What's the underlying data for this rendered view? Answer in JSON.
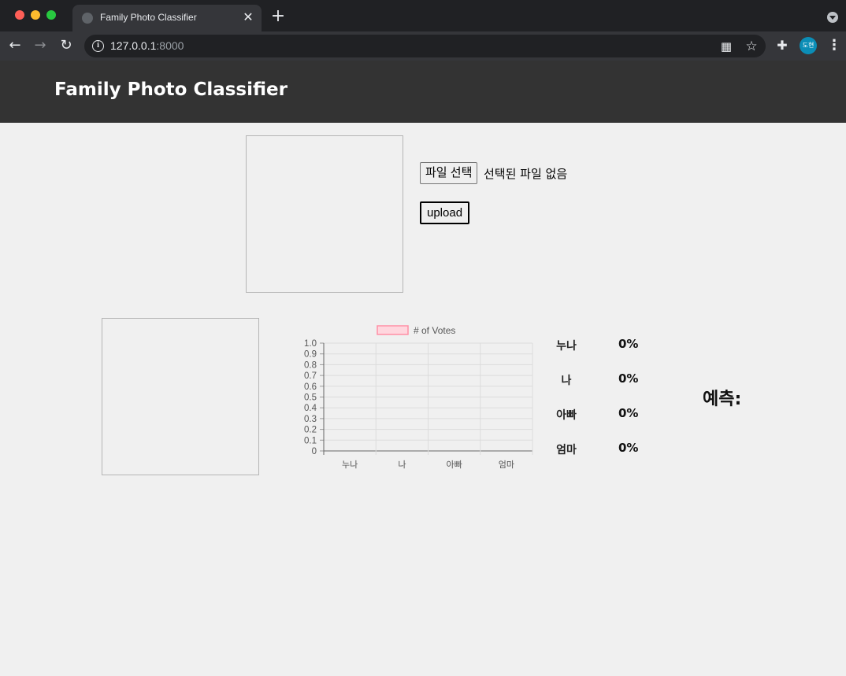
{
  "browser": {
    "tab_title": "Family Photo Classifier",
    "tab_close_glyph": "✕",
    "new_tab_glyph": "+",
    "url_host": "127.0.0.1",
    "url_port": ":8000",
    "profile_initials": "도현"
  },
  "header": {
    "title": "Family Photo Classifier"
  },
  "upload": {
    "file_button_label": "파일 선택",
    "file_status": "선택된 파일 없음",
    "upload_button_label": "upload"
  },
  "results": {
    "items": [
      {
        "label": "누나",
        "value": "0%"
      },
      {
        "label": "나",
        "value": "0%"
      },
      {
        "label": "아빠",
        "value": "0%"
      },
      {
        "label": "엄마",
        "value": "0%"
      }
    ],
    "prediction_label": "예측:"
  },
  "chart_data": {
    "type": "bar",
    "categories": [
      "누나",
      "나",
      "아빠",
      "엄마"
    ],
    "series": [
      {
        "name": "# of Votes",
        "values": [
          0,
          0,
          0,
          0
        ],
        "fill": "#ffd6de",
        "stroke": "#ff8fa6"
      }
    ],
    "ylim": [
      0,
      1.0
    ],
    "yticks": [
      "1.0",
      "0.9",
      "0.8",
      "0.7",
      "0.6",
      "0.5",
      "0.4",
      "0.3",
      "0.2",
      "0.1",
      "0"
    ],
    "grid": true,
    "legend": "top"
  }
}
